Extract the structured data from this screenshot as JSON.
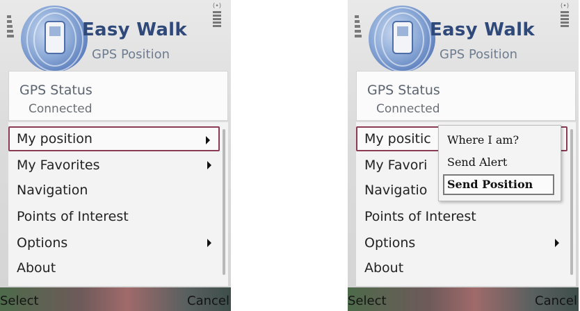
{
  "app": {
    "title": "Easy Walk",
    "subtitle": "GPS Position"
  },
  "status": {
    "title": "GPS Status",
    "value": "Connected"
  },
  "menu": {
    "items": [
      {
        "label": "My position",
        "has_submenu": true
      },
      {
        "label": "My Favorites",
        "has_submenu": true
      },
      {
        "label": "Navigation",
        "has_submenu": false
      },
      {
        "label": "Points of Interest",
        "has_submenu": false
      },
      {
        "label": "Options",
        "has_submenu": true
      },
      {
        "label": "About",
        "has_submenu": false
      }
    ],
    "right_truncated": [
      "My positic",
      "My Favori",
      "Navigatio"
    ]
  },
  "submenu": {
    "items": [
      {
        "label": "Where I am?"
      },
      {
        "label": "Send Alert"
      },
      {
        "label": "Send Position"
      }
    ],
    "selected_index": 2
  },
  "softkeys": {
    "left": "Select",
    "right": "Cancel"
  },
  "colors": {
    "title": "#2f4a7a",
    "selection_border": "#8a3a52"
  },
  "icons": {
    "signal": "signal-strength-icon",
    "battery": "battery-icon",
    "logo": "easy-walk-logo-icon"
  }
}
